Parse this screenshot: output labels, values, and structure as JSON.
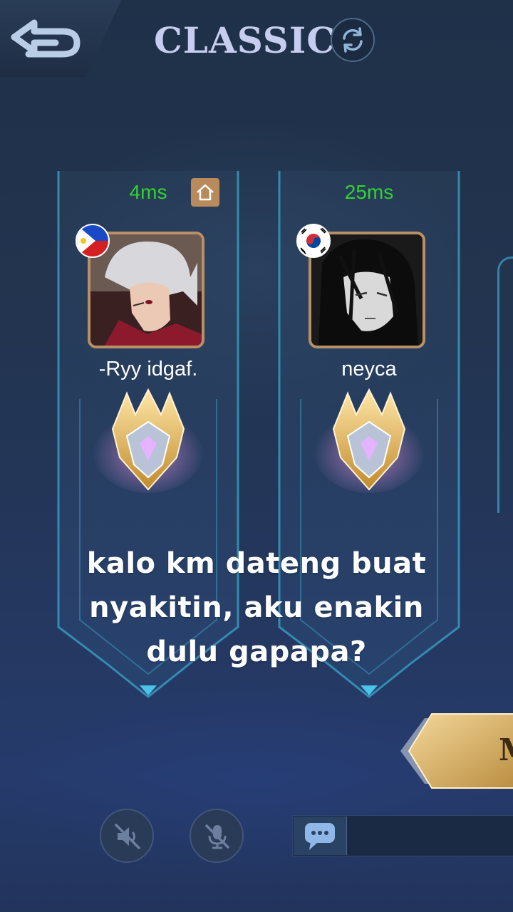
{
  "header": {
    "title": "CLASSIC",
    "back_icon": "back-arrow-icon",
    "refresh_icon": "refresh-icon"
  },
  "players": [
    {
      "ping": "4ms",
      "ping_color": "#33d133",
      "is_host": true,
      "host_icon": "home-icon",
      "flag": "philippines-flag-icon",
      "name": "-Ryy idgaf.",
      "rank_emblem": "mythic-rank-emblem"
    },
    {
      "ping": "25ms",
      "ping_color": "#33d133",
      "is_host": false,
      "flag": "south-korea-flag-icon",
      "name": "neyca",
      "rank_emblem": "mythic-rank-emblem"
    }
  ],
  "caption": {
    "line1": "kalo km dateng buat",
    "line2": "nyakitin, aku enakin",
    "line3": "dulu gapapa?"
  },
  "start_button": {
    "label": "M"
  },
  "bottom": {
    "speaker_icon": "speaker-muted-icon",
    "mic_icon": "mic-muted-icon",
    "chat_icon": "chat-bubble-icon"
  },
  "colors": {
    "accent_gold": "#b99065",
    "frame_cyan": "#3aa6c9",
    "title": "#c7cdee"
  }
}
